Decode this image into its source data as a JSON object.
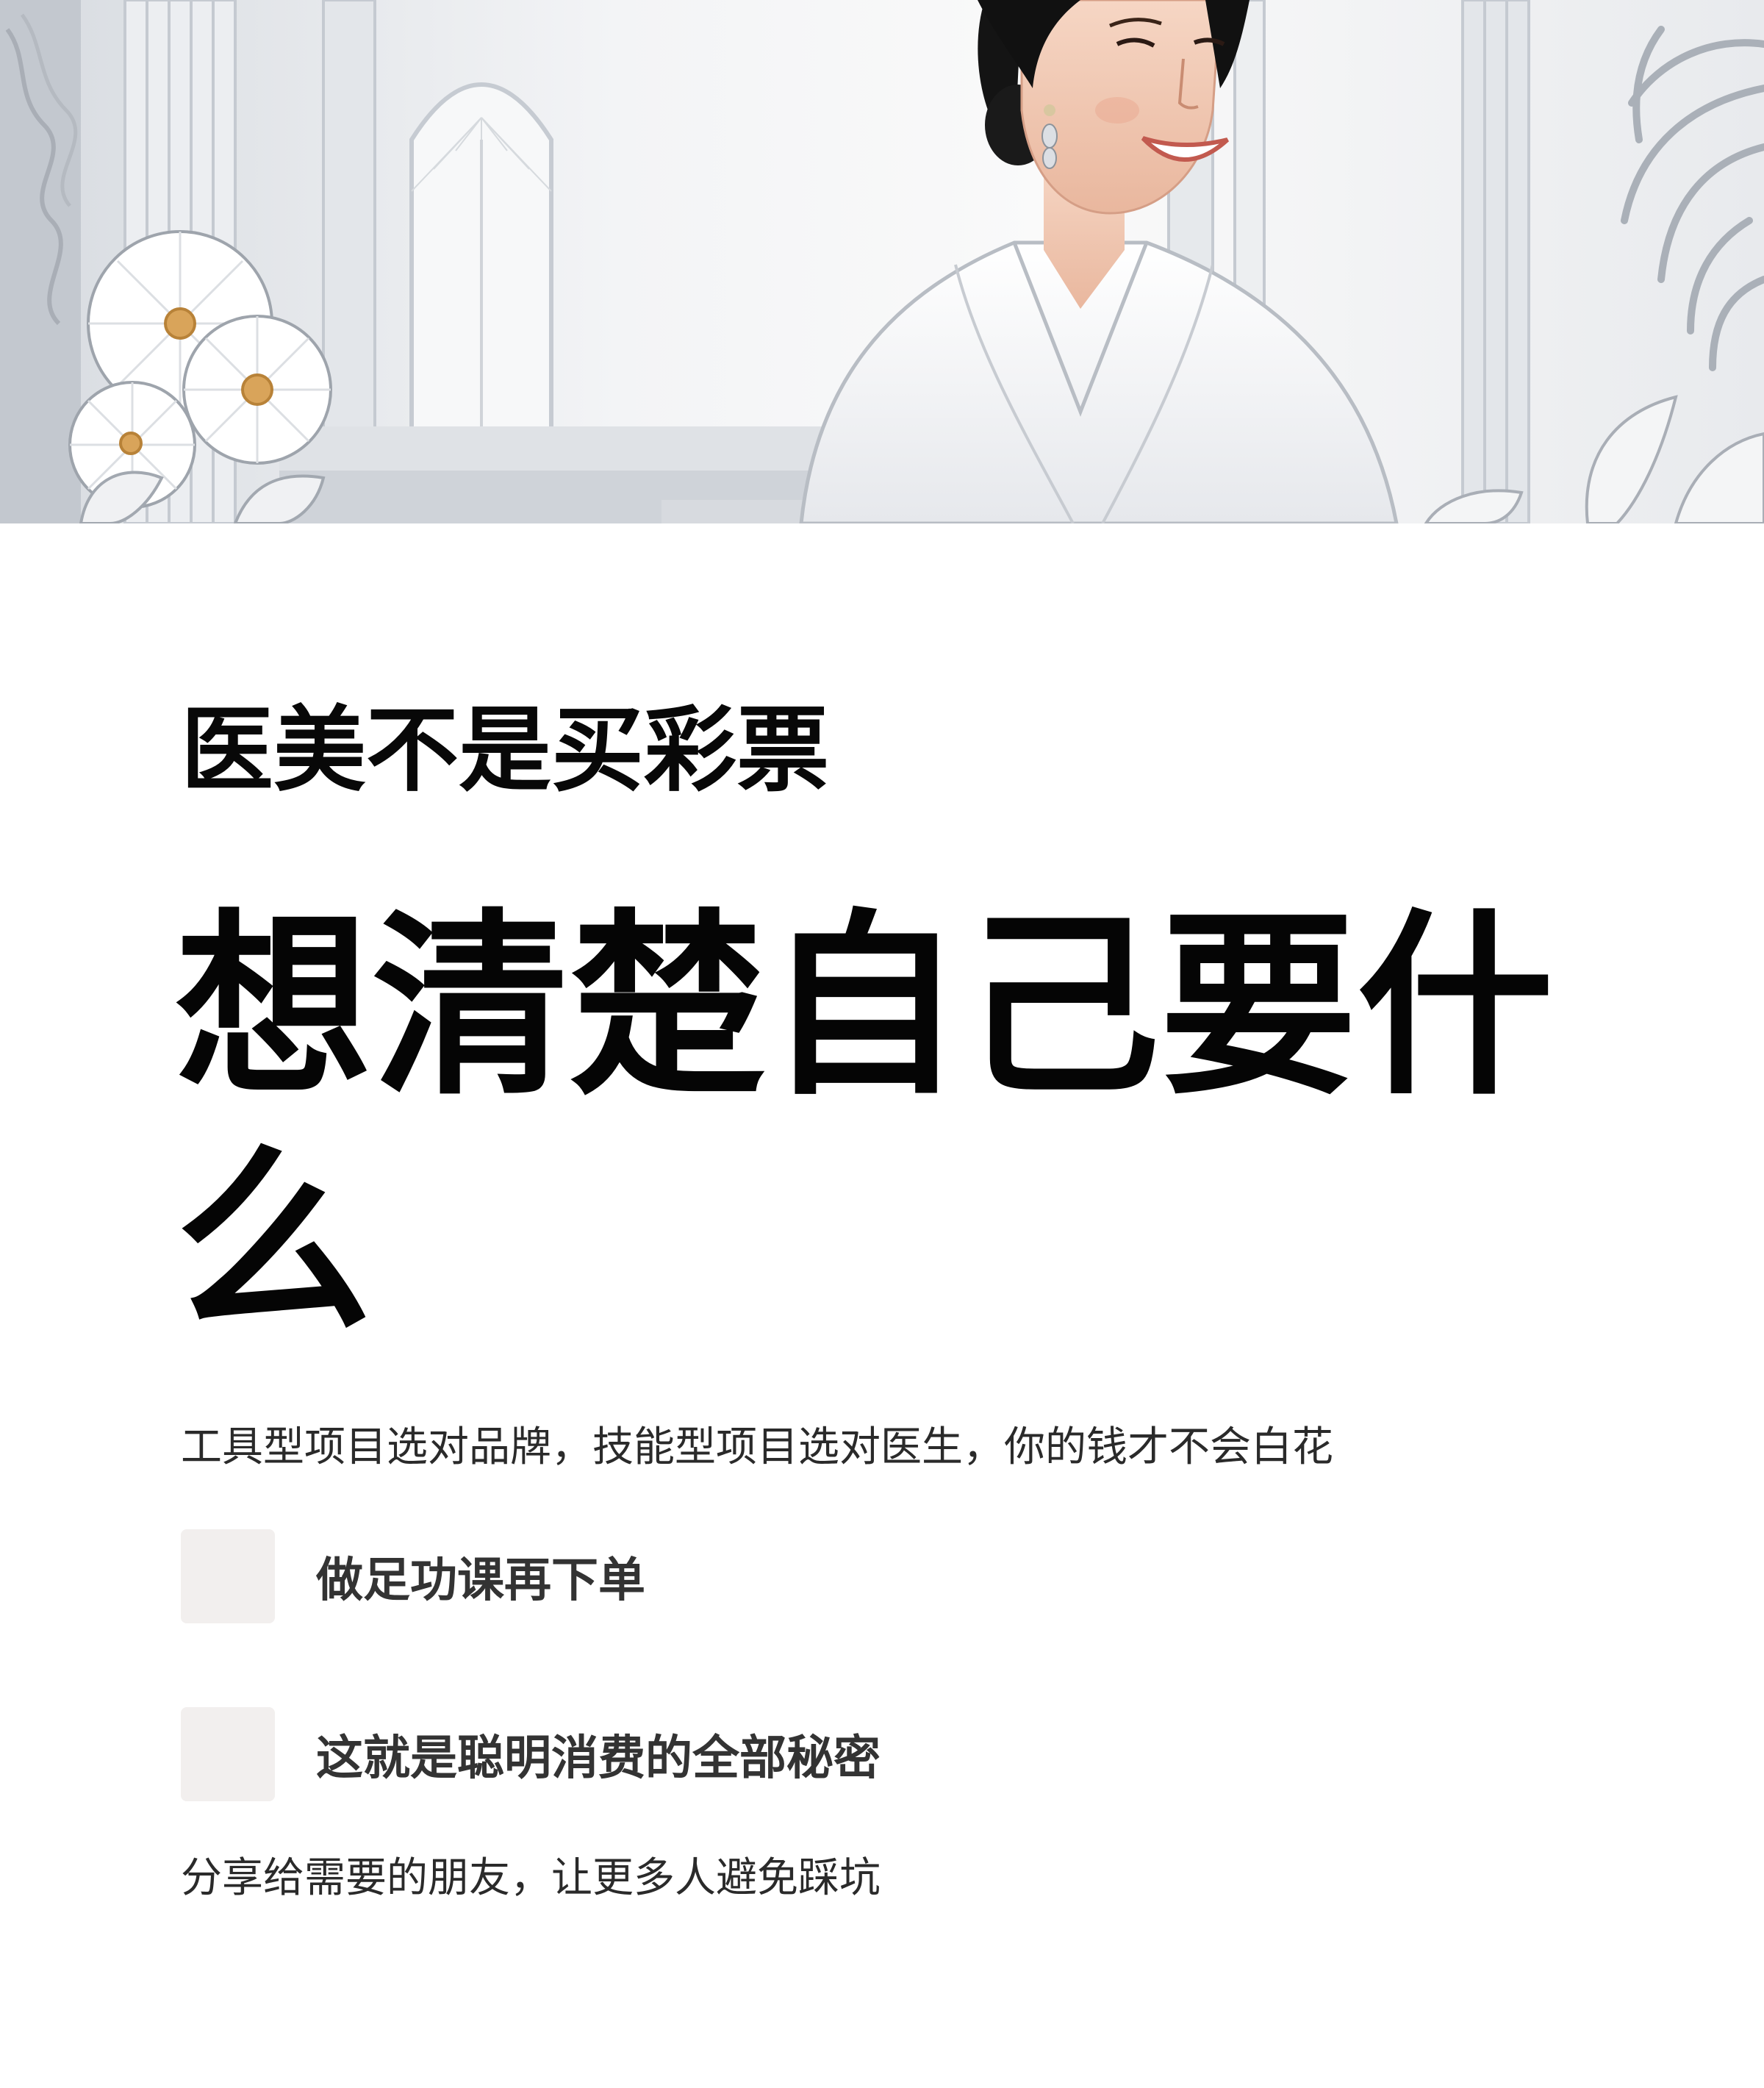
{
  "hero": {
    "illustration": "woman-in-white-robe-illustration"
  },
  "kicker": "医美不是买彩票",
  "headline": "想清楚自己要什么",
  "subtitle": "工具型项目选对品牌，技能型项目选对医生，你的钱才不会白花",
  "points": [
    {
      "label": "做足功课再下单"
    },
    {
      "label": "这就是聪明消费的全部秘密"
    }
  ],
  "footer_note": "分享给需要的朋友，让更多人避免踩坑",
  "colors": {
    "text": "#050505",
    "body_text": "#2a2a2a",
    "point_text": "#333333",
    "point_box": "#f2efee",
    "hero_gray": "#c9cdd3"
  }
}
